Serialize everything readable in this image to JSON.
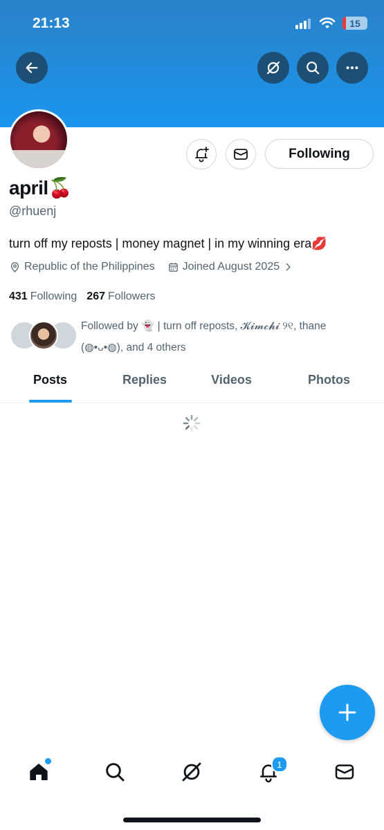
{
  "status_bar": {
    "time": "21:13",
    "battery": "15",
    "battery_level": 0.15
  },
  "header": {
    "back_icon": "arrow-left-icon",
    "grok_icon": "grok-icon",
    "search_icon": "search-icon",
    "more_icon": "more-icon"
  },
  "profile": {
    "display_name": "april",
    "name_emoji": "🍒",
    "handle": "@rhuenj",
    "bio": "turn off my reposts | money magnet | in my winning era",
    "bio_emoji": "💋",
    "location": "Republic of the Philippines",
    "joined": "Joined August 2025",
    "following_count": "431",
    "following_label": "Following",
    "followers_count": "267",
    "followers_label": "Followers",
    "followed_by_line1": "Followed by 👻 | turn off reposts, 𝓚𝓲𝓶𝓬𝓱𝓲 ୨୧, thane",
    "followed_by_line2": "(◍•ᴗ•◍), and 4 others",
    "follow_button_label": "Following"
  },
  "tabs": [
    {
      "label": "Posts",
      "active": true
    },
    {
      "label": "Replies",
      "active": false
    },
    {
      "label": "Videos",
      "active": false
    },
    {
      "label": "Photos",
      "active": false
    }
  ],
  "bottom_nav": {
    "notifications_badge": "1"
  },
  "colors": {
    "accent": "#1d9bf0",
    "banner": "#1b95ee",
    "secondary_text": "#536471"
  }
}
